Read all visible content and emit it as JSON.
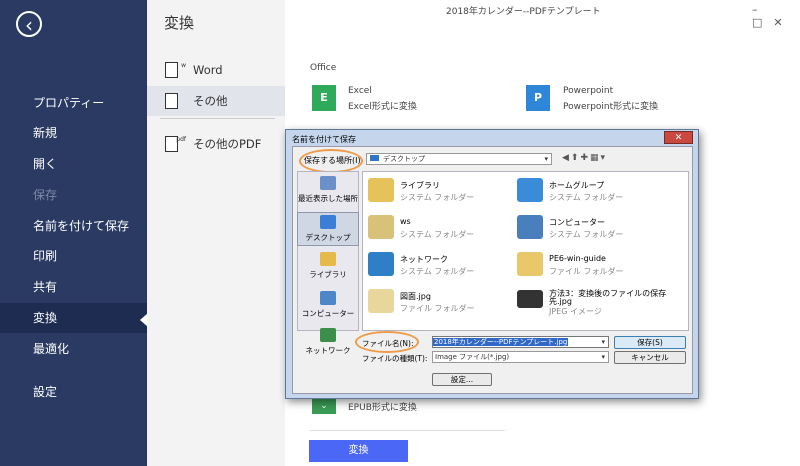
{
  "app": {
    "window_title": "2018年カレンダー--PDFテンプレート",
    "window_controls": [
      "–",
      "□",
      "✕"
    ]
  },
  "sidebar": {
    "items": [
      {
        "label": "プロパティー"
      },
      {
        "label": "新規"
      },
      {
        "label": "開く"
      },
      {
        "label": "保存"
      },
      {
        "label": "名前を付けて保存"
      },
      {
        "label": "印刷"
      },
      {
        "label": "共有"
      },
      {
        "label": "変換"
      },
      {
        "label": "最適化"
      },
      {
        "label": "設定"
      }
    ]
  },
  "convert_panel": {
    "title": "変換",
    "items": [
      {
        "label": "Word",
        "icon_tag": "w"
      },
      {
        "label": "その他",
        "icon_tag": ""
      },
      {
        "label": "その他のPDF",
        "icon_tag": "pdf"
      }
    ]
  },
  "main": {
    "section_label": "Office",
    "tiles": [
      {
        "title": "Excel",
        "subtitle": "Excel形式に変換",
        "icon_letter": "E",
        "color": "#2faa5a"
      },
      {
        "title": "Powerpoint",
        "subtitle": "Powerpoint形式に変換",
        "icon_letter": "P",
        "color": "#2f86d8"
      }
    ],
    "epub_label": "EPUB形式に変換",
    "convert_button": "変換"
  },
  "dialog": {
    "title": "名前を付けて保存",
    "close": "✕",
    "save_in_label": "保存する場所(I):",
    "save_in_value": "デスクトップ",
    "places": [
      {
        "label": "最近表示した場所",
        "color": "#6b8fc9"
      },
      {
        "label": "デスクトップ",
        "color": "#3a7fd5"
      },
      {
        "label": "ライブラリ",
        "color": "#e5b94a"
      },
      {
        "label": "コンピューター",
        "color": "#4c86c9"
      },
      {
        "label": "ネットワーク",
        "color": "#3c8f4a"
      }
    ],
    "files": [
      {
        "name": "ライブラリ",
        "type": "システム フォルダー",
        "color": "#e5c25a"
      },
      {
        "name": "ホームグループ",
        "type": "システム フォルダー",
        "color": "#3a8cd8"
      },
      {
        "name": "ws",
        "type": "システム フォルダー",
        "color": "#d8c27a"
      },
      {
        "name": "コンピューター",
        "type": "システム フォルダー",
        "color": "#4a7fbd"
      },
      {
        "name": "ネットワーク",
        "type": "システム フォルダー",
        "color": "#2f7fc7"
      },
      {
        "name": "PE6-win-guide",
        "type": "ファイル フォルダー",
        "color": "#e8c86a"
      },
      {
        "name": "図面.jpg",
        "type": "ファイル フォルダー",
        "color": "#e8d69a"
      },
      {
        "name": "方法3：変換後のファイルの保存",
        "name2": "先.jpg",
        "type": "JPEG イメージ",
        "color": "#333333"
      }
    ],
    "filename_label": "ファイル名(N):",
    "filename_value": "2018年カレンダー--PDFテンプレート.jpg",
    "filetype_label": "ファイルの種類(T):",
    "filetype_value": "Image ファイル(*.jpg)",
    "save_button": "保存(S)",
    "cancel_button": "キャンセル",
    "settings_button": "設定..."
  }
}
